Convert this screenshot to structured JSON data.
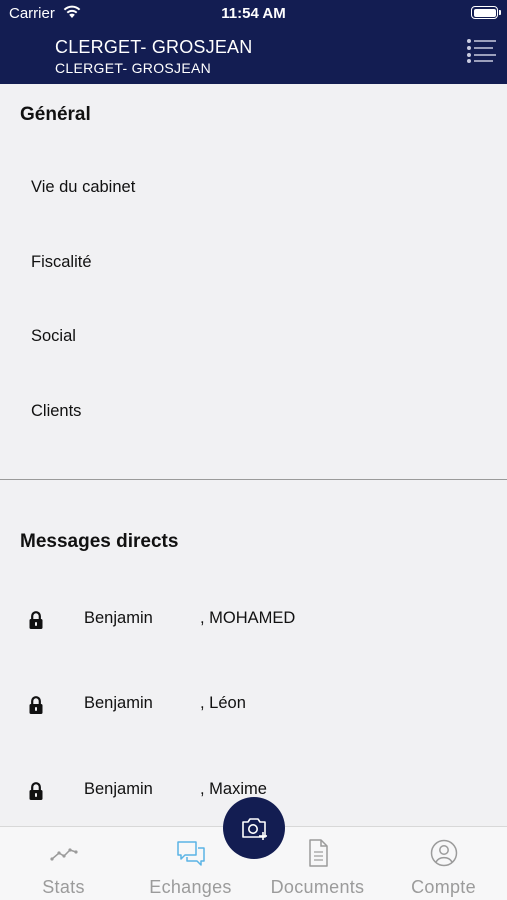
{
  "status_bar": {
    "carrier": "Carrier",
    "time": "11:54 AM"
  },
  "header": {
    "title": "CLERGET- GROSJEAN",
    "subtitle": "CLERGET- GROSJEAN",
    "menu_icon": "list-menu-icon"
  },
  "general": {
    "title": "Général",
    "channels": [
      "Vie du cabinet",
      "Fiscalité",
      "Social",
      "Clients"
    ]
  },
  "direct_messages": {
    "title": "Messages directs",
    "items": [
      {
        "first": "Benjamin",
        "last": ", MOHAMED"
      },
      {
        "first": "Benjamin",
        "last": ", Léon"
      },
      {
        "first": "Benjamin",
        "last": ", Maxime"
      }
    ]
  },
  "tabbar": {
    "tabs": [
      {
        "label": "Stats",
        "icon": "chart-line-icon"
      },
      {
        "label": "Echanges",
        "icon": "chat-bubbles-icon"
      },
      {
        "label": "Documents",
        "icon": "document-icon"
      },
      {
        "label": "Compte",
        "icon": "user-circle-icon"
      }
    ],
    "active_index": 1,
    "camera_icon": "camera-add-icon"
  },
  "colors": {
    "header_bg": "#131d52",
    "accent": "#5ab4e6",
    "inactive": "#9b9b9b",
    "background": "#f1f1f3"
  }
}
